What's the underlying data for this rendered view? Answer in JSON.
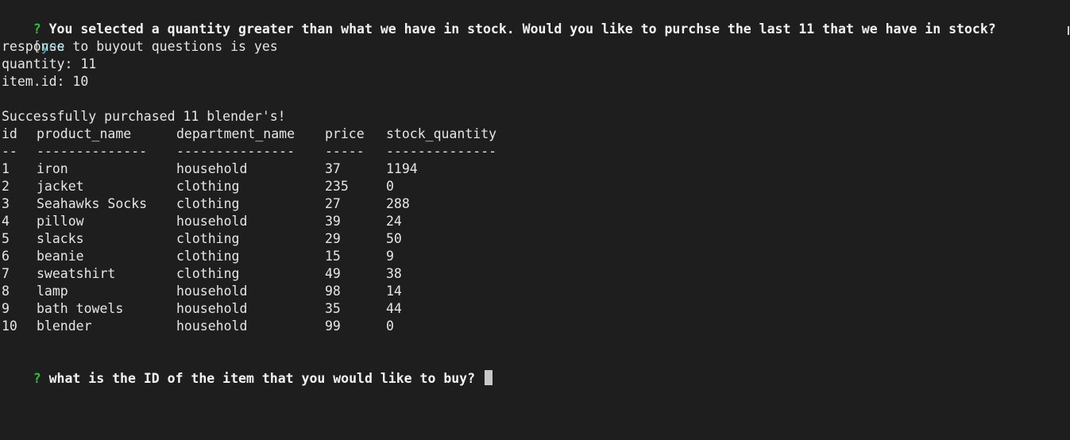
{
  "prompt_marker": "?",
  "stock_question": "You selected a quantity greater than what we have in stock. Would you like to purchse the last 11 that we have in stock?",
  "answer_bracket": "[",
  "answer": "yes",
  "log_lines": [
    "response to buyout questions is yes",
    "quantity: 11",
    "item.id: 10",
    "",
    "Successfully purchased 11 blender's!"
  ],
  "table": {
    "headers": [
      "id",
      "product_name",
      "department_name",
      "price",
      "stock_quantity"
    ],
    "separators": [
      "--",
      "--------------",
      "---------------",
      "-----",
      "--------------"
    ],
    "rows": [
      [
        "1",
        "iron",
        "household",
        "37",
        "1194"
      ],
      [
        "2",
        "jacket",
        "clothing",
        "235",
        "0"
      ],
      [
        "3",
        "Seahawks Socks",
        "clothing",
        "27",
        "288"
      ],
      [
        "4",
        "pillow",
        "household",
        "39",
        "24"
      ],
      [
        "5",
        "slacks",
        "clothing",
        "29",
        "50"
      ],
      [
        "6",
        "beanie",
        "clothing",
        "15",
        "9"
      ],
      [
        "7",
        "sweatshirt",
        "clothing",
        "49",
        "38"
      ],
      [
        "8",
        "lamp",
        "household",
        "98",
        "14"
      ],
      [
        "9",
        "bath towels",
        "household",
        "35",
        "44"
      ],
      [
        "10",
        "blender",
        "household",
        "99",
        "0"
      ]
    ]
  },
  "id_question": "what is the ID of the item that you would like to buy?"
}
